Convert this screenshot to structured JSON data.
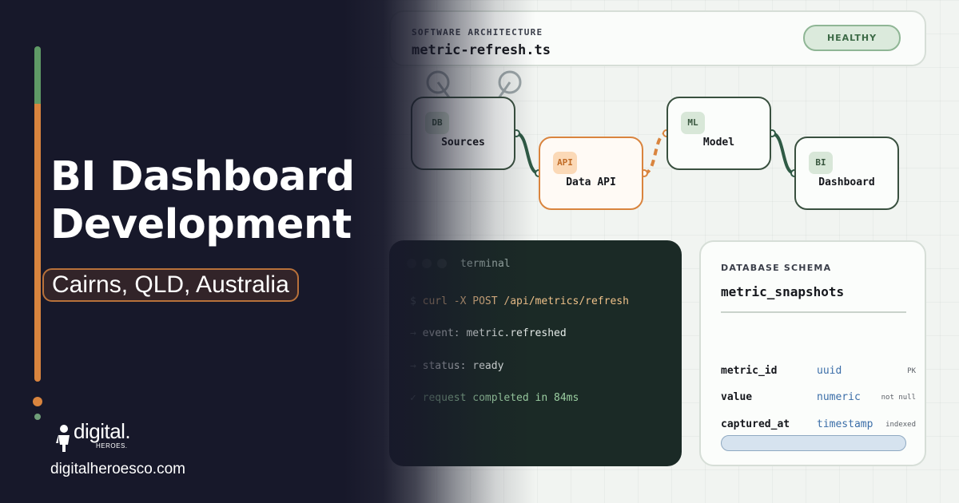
{
  "brand": {
    "title_line1": "BI Dashboard",
    "title_line2": "Development",
    "location": "Cairns, QLD, Australia",
    "logo_word": "digital.",
    "logo_sub": "HEROES.",
    "website": "digitalheroesco.com",
    "colors": {
      "accent_orange": "#d9843e",
      "accent_green": "#5f9a66",
      "panel_dark": "#17182a"
    }
  },
  "header": {
    "eyebrow": "SOFTWARE ARCHITECTURE",
    "filename": "metric-refresh.ts",
    "status": "HEALTHY",
    "status_color": "#3c6a46"
  },
  "flow": {
    "nodes": [
      {
        "badge": "DB",
        "label": "Sources"
      },
      {
        "badge": "API",
        "label": "Data API"
      },
      {
        "badge": "ML",
        "label": "Model"
      },
      {
        "badge": "BI",
        "label": "Dashboard"
      }
    ]
  },
  "terminal": {
    "title": "terminal",
    "lines": [
      {
        "prefix": "$",
        "text": "curl -X POST /api/metrics/refresh"
      },
      {
        "prefix": "→",
        "text": "event: metric.refreshed"
      },
      {
        "prefix": "→",
        "text": "status: ready"
      },
      {
        "prefix": "✓",
        "text": "request completed in 84ms"
      }
    ]
  },
  "schema": {
    "eyebrow": "DATABASE SCHEMA",
    "table": "metric_snapshots",
    "fields": [
      {
        "name": "metric_id",
        "type": "uuid",
        "flag": "PK"
      },
      {
        "name": "value",
        "type": "numeric",
        "flag": "not null"
      },
      {
        "name": "captured_at",
        "type": "timestamp",
        "flag": "indexed"
      }
    ]
  }
}
